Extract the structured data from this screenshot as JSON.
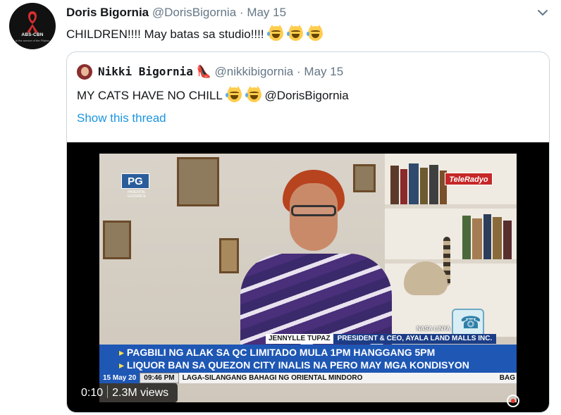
{
  "tweet": {
    "name": "Doris Bigornia",
    "handle": "@DorisBigornia",
    "dot": "·",
    "date": "May 15",
    "text": "CHILDREN!!!! May batas sa studio!!!!",
    "emojis": [
      "joy-cat-emoji",
      "joy-cat-emoji",
      "joy-cat-emoji"
    ],
    "avatar_logo": "ABS-CBN",
    "avatar_sub": "In the service of the Filipino"
  },
  "quoted": {
    "name": "Nikki Bigornia",
    "name_glyph": "👠",
    "handle": "@nikkibigornia",
    "dot": "·",
    "date": "May 15",
    "text": "MY CATS HAVE NO CHILL",
    "mention": "@DorisBigornia",
    "show_thread": "Show this thread"
  },
  "video": {
    "time": "0:10",
    "views": "2.3M views",
    "pg_badge": "PG",
    "pg_sub": "PARENTAL GUIDANCE",
    "channel_logo": "TeleRadyo",
    "nasa_label": "NASA LINYA",
    "lower_third_name": "JENNYLLE TUPAZ",
    "lower_third_title": "PRESIDENT & CEO, AYALA LAND MALLS INC.",
    "headline_1": "PAGBILI NG ALAK SA QC LIMITADO MULA 1PM HANGGANG 5PM",
    "headline_2": "LIQUOR BAN SA QUEZON CITY INALIS NA PERO MAY MGA KONDISYON",
    "bullet": "▸",
    "crawl_date": "15 May 20",
    "crawl_time": "09:46 PM",
    "crawl_text": "LAGA-SILANGANG BAHAGI NG ORIENTAL MINDORO",
    "crawl_end": "BAG"
  },
  "colors": {
    "link_blue": "#1b95e0",
    "muted_gray": "#657786",
    "ticker_blue": "#1e57b4",
    "border": "#ccd6dd"
  }
}
